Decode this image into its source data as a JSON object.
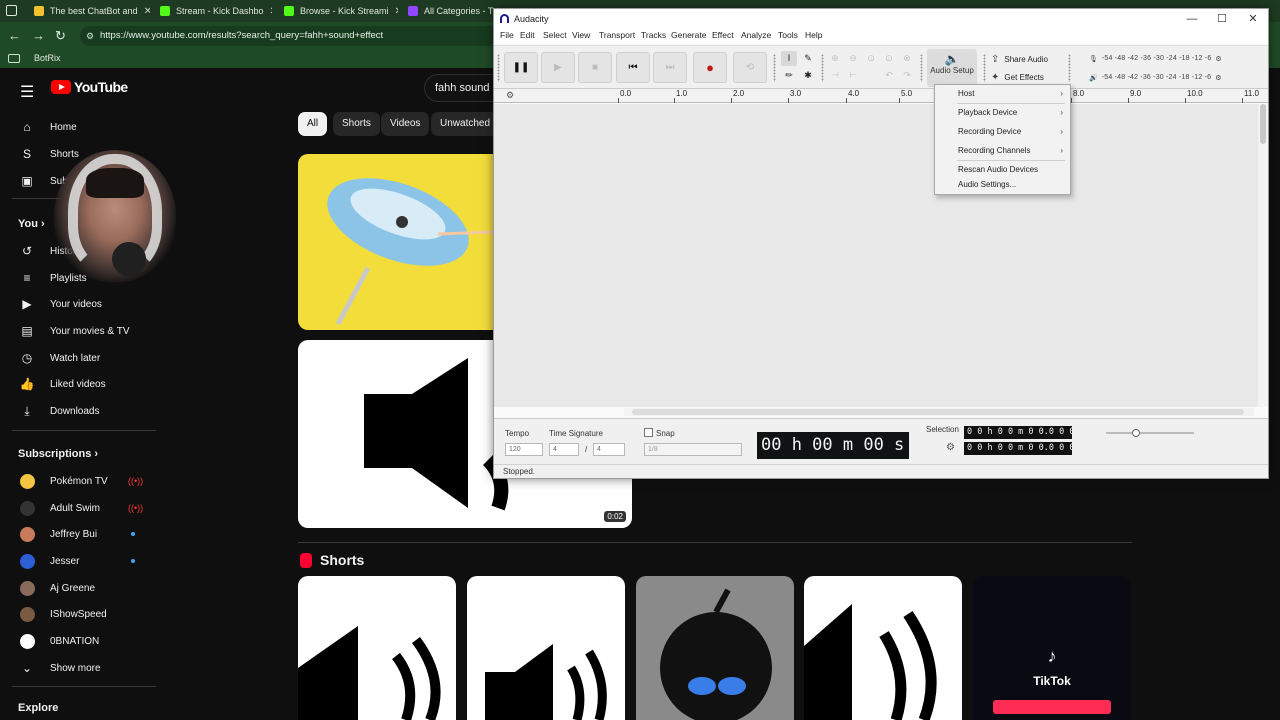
{
  "browser": {
    "tabs": [
      {
        "title": "The best ChatBot and",
        "color": "#f2c230"
      },
      {
        "title": "Stream - Kick Dashbo",
        "color": "#53fc18"
      },
      {
        "title": "Browse - Kick Streami",
        "color": "#53fc18"
      },
      {
        "title": "All Categories - Twit",
        "color": "#9146ff"
      }
    ],
    "tab_close": "✕",
    "url": "https://www.youtube.com/results?search_query=fahh+sound+effect",
    "bookmark": "BotRix",
    "nav": {
      "back": "←",
      "forward": "→",
      "reload": "↻"
    }
  },
  "youtube": {
    "logo_text": "YouTube",
    "search_value": "fahh sound e",
    "sidebar": {
      "main": [
        {
          "label": "Home",
          "icon": "⌂"
        },
        {
          "label": "Shorts",
          "icon": "S"
        },
        {
          "label": "Subscriptions",
          "icon": "▣"
        }
      ],
      "you_heading": "You",
      "you_chevron": "›",
      "you_items": [
        {
          "label": "History",
          "icon": "↺"
        },
        {
          "label": "Playlists",
          "icon": "≡"
        },
        {
          "label": "Your videos",
          "icon": "▶"
        },
        {
          "label": "Your movies & TV",
          "icon": "▤"
        },
        {
          "label": "Watch later",
          "icon": "◷"
        },
        {
          "label": "Liked videos",
          "icon": "👍"
        },
        {
          "label": "Downloads",
          "icon": "⤓"
        }
      ],
      "subs_heading": "Subscriptions",
      "subs_chevron": "›",
      "subscriptions": [
        {
          "label": "Pokémon TV",
          "status": "live",
          "color": "#f4c542"
        },
        {
          "label": "Adult Swim",
          "status": "live",
          "color": "#222222"
        },
        {
          "label": "Jeffrey Bui",
          "status": "new",
          "color": "#c87b5a"
        },
        {
          "label": "Jesser",
          "status": "new",
          "color": "#2c5fd6"
        },
        {
          "label": "Aj Greene",
          "status": "",
          "color": "#8a6a5a"
        },
        {
          "label": "IShowSpeed",
          "status": "",
          "color": "#7a5a40"
        },
        {
          "label": "0BNATION",
          "status": "",
          "color": "#ffffff"
        }
      ],
      "show_more": "Show more",
      "explore_heading": "Explore",
      "live_icon": "((•))"
    },
    "chips": [
      "All",
      "Shorts",
      "Videos",
      "Unwatched"
    ],
    "video2_duration": "0:02",
    "shorts_heading": "Shorts",
    "tiktok_label": "TikTok"
  },
  "audacity": {
    "title": "Audacity",
    "window_controls": {
      "minimize": "—",
      "maximize": "☐",
      "close": "✕"
    },
    "menu": [
      "File",
      "Edit",
      "Select",
      "View",
      "Transport",
      "Tracks",
      "Generate",
      "Effect",
      "Analyze",
      "Tools",
      "Help"
    ],
    "transport": {
      "pause": "❚❚",
      "play": "▶",
      "stop": "■",
      "skip_start": "⏮",
      "skip_end": "⏭",
      "record": "●",
      "loop": "⟲"
    },
    "audio_setup_label": "Audio Setup",
    "share_audio": "Share Audio",
    "get_effects": "Get Effects",
    "meter_scale": "-54 -48 -42 -36 -30 -24 -18 -12  -6",
    "ruler_ticks": [
      "0.0",
      "1.0",
      "2.0",
      "3.0",
      "4.0",
      "5.0",
      "8.0",
      "9.0",
      "10.0",
      "11.0"
    ],
    "tempo_label": "Tempo",
    "tempo_value": "120",
    "time_signature_label": "Time Signature",
    "time_sig_upper": "4",
    "time_sig_lower": "4",
    "time_sig_separator": "/",
    "snap_label": "Snap",
    "snap_value": "1/8",
    "timecode": "00 h 00 m 00 s",
    "selection_label": "Selection",
    "selection_start": "0 0 h 0 0 m 0 0.0 0 0 s",
    "selection_end": "0 0 h 0 0 m 0 0.0 0 0 s",
    "status": "Stopped.",
    "dropdown": {
      "items": [
        {
          "label": "Host",
          "submenu": true
        },
        {
          "label": "Playback Device",
          "submenu": true
        },
        {
          "label": "Recording Device",
          "submenu": true
        },
        {
          "label": "Recording Channels",
          "submenu": true
        },
        {
          "label": "Rescan Audio Devices",
          "submenu": false
        },
        {
          "label": "Audio Settings...",
          "submenu": false
        }
      ],
      "submenu_arrow": "›"
    }
  }
}
